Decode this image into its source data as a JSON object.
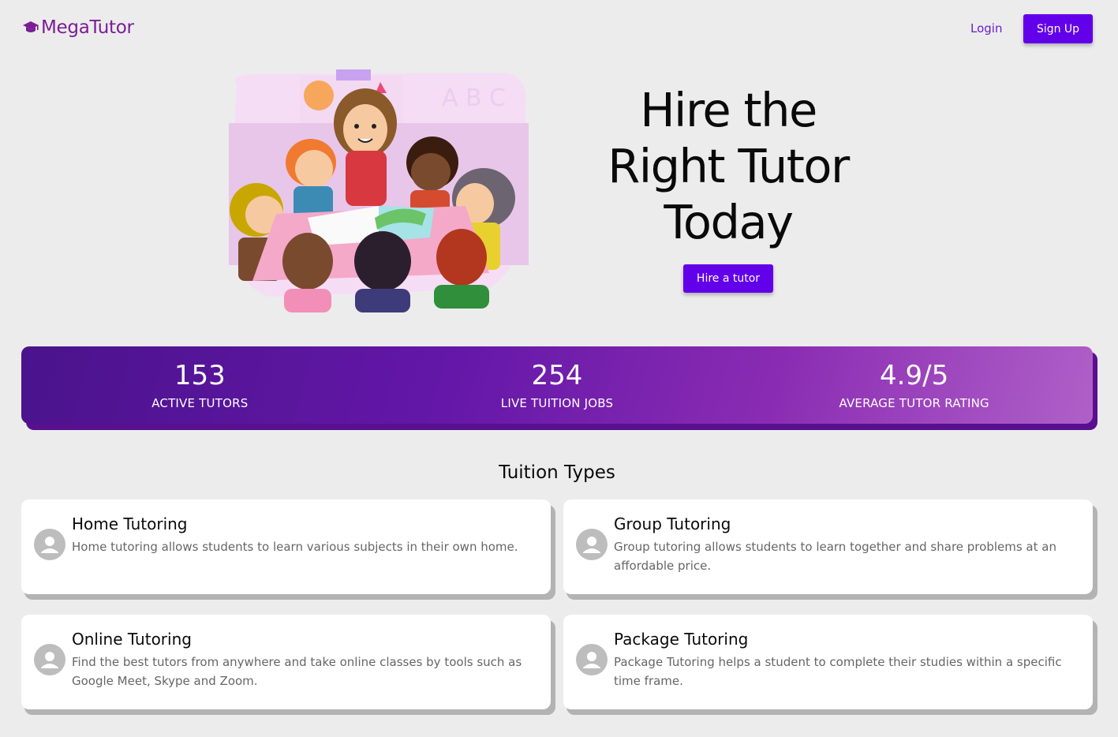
{
  "header": {
    "logo_text": "MegaTutor",
    "login_label": "Login",
    "signup_label": "Sign Up"
  },
  "hero": {
    "title_lines": [
      "Hire the",
      "Right Tutor",
      "Today"
    ],
    "cta_label": "Hire a tutor",
    "illustration_letters": "A B C"
  },
  "stats": [
    {
      "value": "153",
      "label": "ACTIVE TUTORS"
    },
    {
      "value": "254",
      "label": "LIVE TUITION JOBS"
    },
    {
      "value": "4.9/5",
      "label": "AVERAGE TUTOR RATING"
    }
  ],
  "tuition": {
    "section_title": "Tuition Types",
    "cards": [
      {
        "title": "Home Tutoring",
        "description": "Home tutoring allows students to learn various subjects in their own home."
      },
      {
        "title": "Group Tutoring",
        "description": "Group tutoring allows students to learn together and share problems at an affordable price."
      },
      {
        "title": "Online Tutoring",
        "description": "Find the best tutors from anywhere and take online classes by tools such as Google Meet, Skype and Zoom."
      },
      {
        "title": "Package Tutoring",
        "description": "Package Tutoring helps a student to complete their studies within a specific time frame."
      }
    ]
  },
  "colors": {
    "brand": "#7a1e96",
    "primary": "#6200ea",
    "background": "#ececec"
  },
  "icons": {
    "logo_icon": "graduation-cap-icon",
    "card_icon": "person-icon"
  }
}
